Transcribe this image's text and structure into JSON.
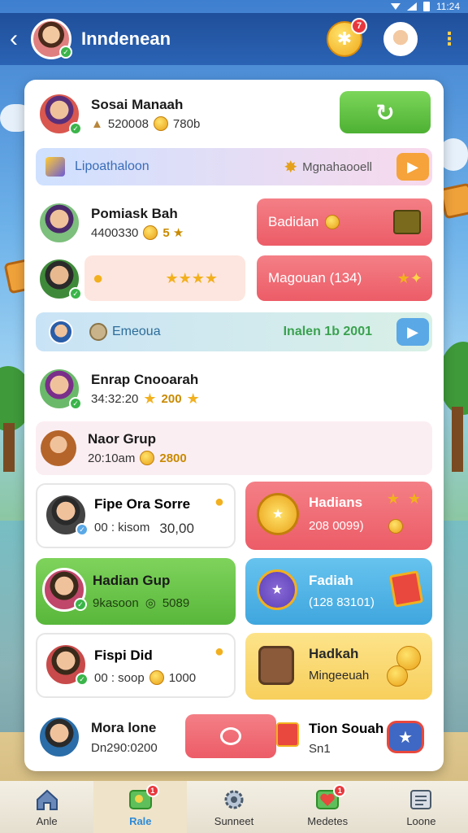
{
  "status_bar": {
    "time": "11:24"
  },
  "header": {
    "title": "Inndenean",
    "coin_badge": "7"
  },
  "rows": {
    "player1": {
      "name": "Sosai Manaah",
      "stat_a": "520008",
      "stat_b": "780b"
    },
    "banner1": {
      "left_label": "Lipoathaloon",
      "right_label": "Mgnahaooell"
    },
    "player2": {
      "name": "Pomiask Bah",
      "stat": "4400330",
      "stars": "5 ★"
    },
    "reward1": {
      "label": "Badidan"
    },
    "reward2": {
      "label": "Magouan (134)"
    },
    "banner2": {
      "left_label": "Emeoua",
      "right_label": "Inalen 1b 2001"
    },
    "player3": {
      "name": "Enrap Cnooarah",
      "stat": "34:32:20",
      "gold": "200"
    },
    "group": {
      "name": "Naor Grup",
      "stat": "20:10am",
      "gold": "2800"
    },
    "tile1": {
      "name": "Fipe Ora Sorre",
      "sub": "00 : kisom",
      "value": "30,00"
    },
    "tile2": {
      "title": "Hadians",
      "sub": "208 0099)"
    },
    "tile3": {
      "name": "Hadian Gup",
      "sub": "9kasoon",
      "value": "5089"
    },
    "tile4": {
      "title": "Fadiah",
      "sub": "(128 83101)"
    },
    "tile5": {
      "name": "Fispi Did",
      "sub": "00 : soop",
      "value": "1000"
    },
    "tile6": {
      "title": "Hadkah",
      "sub": "Mingeeuah"
    },
    "player4": {
      "name": "Mora lone",
      "sub": "Dn290:0200"
    },
    "tile7": {
      "title": "Tion Souah",
      "sub": "Sn1"
    }
  },
  "nav": [
    {
      "label": "Anle",
      "icon": "home-icon",
      "badge": ""
    },
    {
      "label": "Rale",
      "icon": "map-icon",
      "badge": "1"
    },
    {
      "label": "Sunneet",
      "icon": "gear-icon",
      "badge": ""
    },
    {
      "label": "Medetes",
      "icon": "heart-icon",
      "badge": "1"
    },
    {
      "label": "Loone",
      "icon": "list-icon",
      "badge": ""
    }
  ]
}
